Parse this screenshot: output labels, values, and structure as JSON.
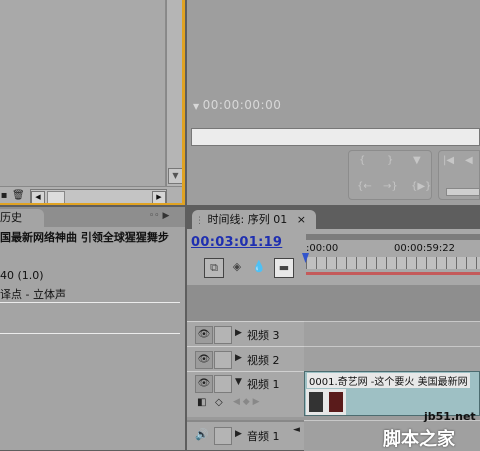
{
  "monitor": {
    "timecode": "00:00:00:00"
  },
  "project_panel": {
    "trash_icon": "trash-icon"
  },
  "history_panel": {
    "tab_label": "历史",
    "title_line": "国最新网络神曲 引领全球猩猩舞步",
    "line1": "40 (1.0)",
    "line2": "译点 - 立体声"
  },
  "timeline": {
    "tab_label": "时间线: 序列 01",
    "close_glyph": "×",
    "current_timecode": "00:03:01:19",
    "ruler_labels": [
      ":00:00",
      "00:00:59:22"
    ],
    "tracks": [
      {
        "name": "视频 3"
      },
      {
        "name": "视频 2"
      },
      {
        "name": "视频 1"
      }
    ],
    "audio_track": "音频 1",
    "clip_label": "0001.奇艺网 -这个要火 美国最新网"
  },
  "watermark": {
    "url": "jb51.net",
    "name": "脚本之家"
  },
  "colors": {
    "active_frame": "#e0a323",
    "timecode_link": "#1f2fb0",
    "work_area_bar": "#c45a5a",
    "clip_fill": "#9ec0c4"
  }
}
